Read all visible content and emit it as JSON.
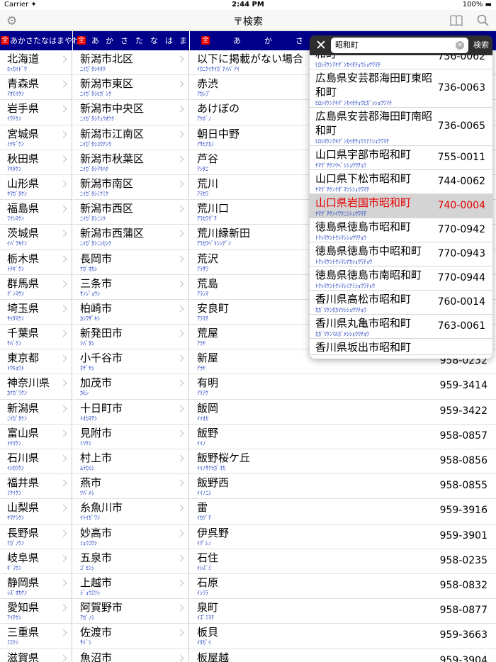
{
  "status": {
    "carrier": "Carrier ✦",
    "time": "2:44 PM",
    "battery": "100%"
  },
  "nav": {
    "title": "〒検索"
  },
  "kanabar": {
    "col1": "あかさたなはまやわ",
    "col2": [
      "あ",
      "か",
      "さ",
      "た",
      "な",
      "は",
      "ま"
    ],
    "col3": [
      "あ",
      "か",
      "さ"
    ],
    "zen": "全"
  },
  "prefectures": [
    {
      "name": "北海道",
      "kana": "ﾎｯｶｲﾄﾞｳ"
    },
    {
      "name": "青森県",
      "kana": "ｱｵﾓﾘｹﾝ"
    },
    {
      "name": "岩手県",
      "kana": "ｲﾜﾃｹﾝ"
    },
    {
      "name": "宮城県",
      "kana": "ﾐﾔｷﾞｹﾝ"
    },
    {
      "name": "秋田県",
      "kana": "ｱｷﾀｹﾝ"
    },
    {
      "name": "山形県",
      "kana": "ﾔﾏｶﾞﾀｹﾝ"
    },
    {
      "name": "福島県",
      "kana": "ﾌｸｼﾏｹﾝ"
    },
    {
      "name": "茨城県",
      "kana": "ｲﾊﾞﾗｷｹﾝ"
    },
    {
      "name": "栃木県",
      "kana": "ﾄﾁｷﾞｹﾝ"
    },
    {
      "name": "群馬県",
      "kana": "ｸﾞﾝﾏｹﾝ"
    },
    {
      "name": "埼玉県",
      "kana": "ｻｲﾀﾏｹﾝ"
    },
    {
      "name": "千葉県",
      "kana": "ﾁﾊﾞｹﾝ"
    },
    {
      "name": "東京都",
      "kana": "ﾄｳｷｮｳﾄ"
    },
    {
      "name": "神奈川県",
      "kana": "ｶﾅｶﾞﾜｹﾝ"
    },
    {
      "name": "新潟県",
      "kana": "ﾆｲｶﾞﾀｹﾝ"
    },
    {
      "name": "富山県",
      "kana": "ﾄﾔﾏｹﾝ"
    },
    {
      "name": "石川県",
      "kana": "ｲｼｶﾜｹﾝ"
    },
    {
      "name": "福井県",
      "kana": "ﾌｸｲｹﾝ"
    },
    {
      "name": "山梨県",
      "kana": "ﾔﾏﾅｼｹﾝ"
    },
    {
      "name": "長野県",
      "kana": "ﾅｶﾞﾉｹﾝ"
    },
    {
      "name": "岐阜県",
      "kana": "ｷﾞﾌｹﾝ"
    },
    {
      "name": "静岡県",
      "kana": "ｼｽﾞｵｶｹﾝ"
    },
    {
      "name": "愛知県",
      "kana": "ｱｲﾁｹﾝ"
    },
    {
      "name": "三重県",
      "kana": "ﾐｴｹﾝ"
    },
    {
      "name": "滋賀県",
      "kana": ""
    }
  ],
  "cities": [
    {
      "name": "新潟市北区",
      "kana": "ﾆｲｶﾞﾀｼｷﾀｸ"
    },
    {
      "name": "新潟市東区",
      "kana": "ﾆｲｶﾞﾀｼﾋｶﾞｼｸ"
    },
    {
      "name": "新潟市中央区",
      "kana": "ﾆｲｶﾞﾀｼﾁｭｳｵｳｸ"
    },
    {
      "name": "新潟市江南区",
      "kana": "ﾆｲｶﾞﾀｼｺｳﾅﾝｸ"
    },
    {
      "name": "新潟市秋葉区",
      "kana": "ﾆｲｶﾞﾀｼｱｷﾊｸ"
    },
    {
      "name": "新潟市南区",
      "kana": "ﾆｲｶﾞﾀｼﾐﾅﾐｸ"
    },
    {
      "name": "新潟市西区",
      "kana": "ﾆｲｶﾞﾀｼﾆｼｸ"
    },
    {
      "name": "新潟市西蒲区",
      "kana": "ﾆｲｶﾞﾀｼﾆｼｶﾝｸ"
    },
    {
      "name": "長岡市",
      "kana": "ﾅｶﾞｵｶｼ"
    },
    {
      "name": "三条市",
      "kana": "ｻﾝｼﾞｮｳｼ"
    },
    {
      "name": "柏崎市",
      "kana": "ｶｼﾜｻﾞｷｼ"
    },
    {
      "name": "新発田市",
      "kana": "ｼﾊﾞﾀｼ"
    },
    {
      "name": "小千谷市",
      "kana": "ｵﾁﾞﾔｼ"
    },
    {
      "name": "加茂市",
      "kana": "ｶﾓｼ"
    },
    {
      "name": "十日町市",
      "kana": "ﾄｵｶﾏﾁｼ"
    },
    {
      "name": "見附市",
      "kana": "ﾐﾂｹｼ"
    },
    {
      "name": "村上市",
      "kana": "ﾑﾗｶﾐｼ"
    },
    {
      "name": "燕市",
      "kana": "ﾂﾊﾞﾒｼ"
    },
    {
      "name": "糸魚川市",
      "kana": "ｲﾄｲｶﾞﾜｼ"
    },
    {
      "name": "妙高市",
      "kana": "ﾐｮｳｺｳｼ"
    },
    {
      "name": "五泉市",
      "kana": "ｺﾞｾﾝｼ"
    },
    {
      "name": "上越市",
      "kana": "ｼﾞｮｳｴﾂｼ"
    },
    {
      "name": "阿賀野市",
      "kana": "ｱｶﾞﾉｼ"
    },
    {
      "name": "佐渡市",
      "kana": "ｻﾄﾞｼ"
    },
    {
      "name": "魚沼市",
      "kana": ""
    }
  ],
  "towns": [
    {
      "name": "以下に掲載がない場合",
      "kana": "ｲｶﾆｹｲｻｲｶﾞﾅｲﾊﾞｱｲ",
      "zip": ""
    },
    {
      "name": "赤渋",
      "kana": "ｱｶｼﾌﾞ",
      "zip": ""
    },
    {
      "name": "あけぼの",
      "kana": "ｱｹﾎﾞﾉ",
      "zip": ""
    },
    {
      "name": "朝日中野",
      "kana": "ｱｻﾋﾅｶﾉ",
      "zip": ""
    },
    {
      "name": "芦谷",
      "kana": "ｱｼﾀﾆ",
      "zip": ""
    },
    {
      "name": "荒川",
      "kana": "ｱﾗｶﾜ",
      "zip": ""
    },
    {
      "name": "荒川口",
      "kana": "ｱﾗｶﾜｸﾞﾁ",
      "zip": ""
    },
    {
      "name": "荒川縁新田",
      "kana": "ｱﾗｶﾜﾍﾞﾘｼﾝﾃﾞﾝ",
      "zip": ""
    },
    {
      "name": "荒沢",
      "kana": "ｱﾗｻﾜ",
      "zip": ""
    },
    {
      "name": "荒島",
      "kana": "ｱﾗｼﾏ",
      "zip": ""
    },
    {
      "name": "安良町",
      "kana": "ｱﾗﾏﾁ",
      "zip": ""
    },
    {
      "name": "荒屋",
      "kana": "ｱﾗﾔ",
      "zip": ""
    },
    {
      "name": "新屋",
      "kana": "ｱﾗﾔ",
      "zip": "958-0232"
    },
    {
      "name": "有明",
      "kana": "ｱﾘｱｹ",
      "zip": "959-3414"
    },
    {
      "name": "飯岡",
      "kana": "ｲｲｵｶ",
      "zip": "959-3422"
    },
    {
      "name": "飯野",
      "kana": "ｲｲﾉ",
      "zip": "958-0857"
    },
    {
      "name": "飯野桜ケ丘",
      "kana": "ｲｲﾉｻｸﾗｶﾞｵｶ",
      "zip": "958-0856"
    },
    {
      "name": "飯野西",
      "kana": "ｲｲﾉﾆｼ",
      "zip": "958-0855"
    },
    {
      "name": "雷",
      "kana": "ｲｶﾂﾞﾁ",
      "zip": "959-3916"
    },
    {
      "name": "伊呉野",
      "kana": "ｲｸﾞﾚﾉ",
      "zip": "959-3901"
    },
    {
      "name": "石住",
      "kana": "ｲｼｽﾞﾐ",
      "zip": "958-0235"
    },
    {
      "name": "石原",
      "kana": "ｲｼﾜﾗ",
      "zip": "958-0832"
    },
    {
      "name": "泉町",
      "kana": "ｲｽﾞﾐﾏﾁ",
      "zip": "958-0877"
    },
    {
      "name": "板貝",
      "kana": "ｲﾀｶﾞｲ",
      "zip": "959-3663"
    },
    {
      "name": "板屋越",
      "kana": "",
      "zip": "959-3904"
    }
  ],
  "search": {
    "value": "昭和町",
    "button": "検索",
    "close": "✕",
    "results": [
      {
        "addr": "和町",
        "reading": "ﾋﾛｼﾏｹﾝｱｷｸﾞﾝｶｲﾀﾁｮｳｼｮｳﾜﾏﾁ",
        "zip": "736-0062",
        "hl": false
      },
      {
        "addr": "広島県安芸郡海田町東昭和町",
        "reading": "ﾋﾛｼﾏｹﾝｱｷｸﾞﾝｶｲﾀﾁｮｳﾋｶﾞｼｼｮｳﾜﾏﾁ",
        "zip": "736-0063",
        "hl": false
      },
      {
        "addr": "広島県安芸郡海田町南昭和町",
        "reading": "ﾋﾛｼﾏｹﾝｱｷｸﾞﾝｶｲﾀﾁｮｳﾐﾅﾐｼｮｳﾜﾏﾁ",
        "zip": "736-0065",
        "hl": false
      },
      {
        "addr": "山口県宇部市昭和町",
        "reading": "ﾔﾏｸﾞﾁｹﾝｳﾍﾞｼｼｮｳﾜﾁｮｳ",
        "zip": "755-0011",
        "hl": false
      },
      {
        "addr": "山口県下松市昭和町",
        "reading": "ﾔﾏｸﾞﾁｹﾝｸﾀﾞﾏﾂｼｼｮｳﾜﾏﾁ",
        "zip": "744-0062",
        "hl": false
      },
      {
        "addr": "山口県岩国市昭和町",
        "reading": "ﾔﾏｸﾞﾁｹﾝｲﾜｸﾆｼｼｮｳﾜﾏﾁ",
        "zip": "740-0004",
        "hl": true
      },
      {
        "addr": "徳島県徳島市昭和町",
        "reading": "ﾄｸｼﾏｹﾝﾄｸｼﾏｼｼｮｳﾜﾁｮｳ",
        "zip": "770-0942",
        "hl": false
      },
      {
        "addr": "徳島県徳島市中昭和町",
        "reading": "ﾄｸｼﾏｹﾝﾄｸｼﾏｼﾅｶｼｮｳﾜﾁｮｳ",
        "zip": "770-0943",
        "hl": false
      },
      {
        "addr": "徳島県徳島市南昭和町",
        "reading": "ﾄｸｼﾏｹﾝﾄｸｼﾏｼﾐﾅﾐｼｮｳﾜﾁｮｳ",
        "zip": "770-0944",
        "hl": false
      },
      {
        "addr": "香川県高松市昭和町",
        "reading": "ｶｶﾞﾜｹﾝﾀｶﾏﾂｼｼｮｳﾜﾁｮｳ",
        "zip": "760-0014",
        "hl": false
      },
      {
        "addr": "香川県丸亀市昭和町",
        "reading": "ｶｶﾞﾜｹﾝﾏﾙｶﾞﾒｼｼｮｳﾜﾁｮｳ",
        "zip": "763-0061",
        "hl": false
      },
      {
        "addr": "香川県坂出市昭和町",
        "reading": "",
        "zip": "",
        "hl": false
      }
    ]
  }
}
